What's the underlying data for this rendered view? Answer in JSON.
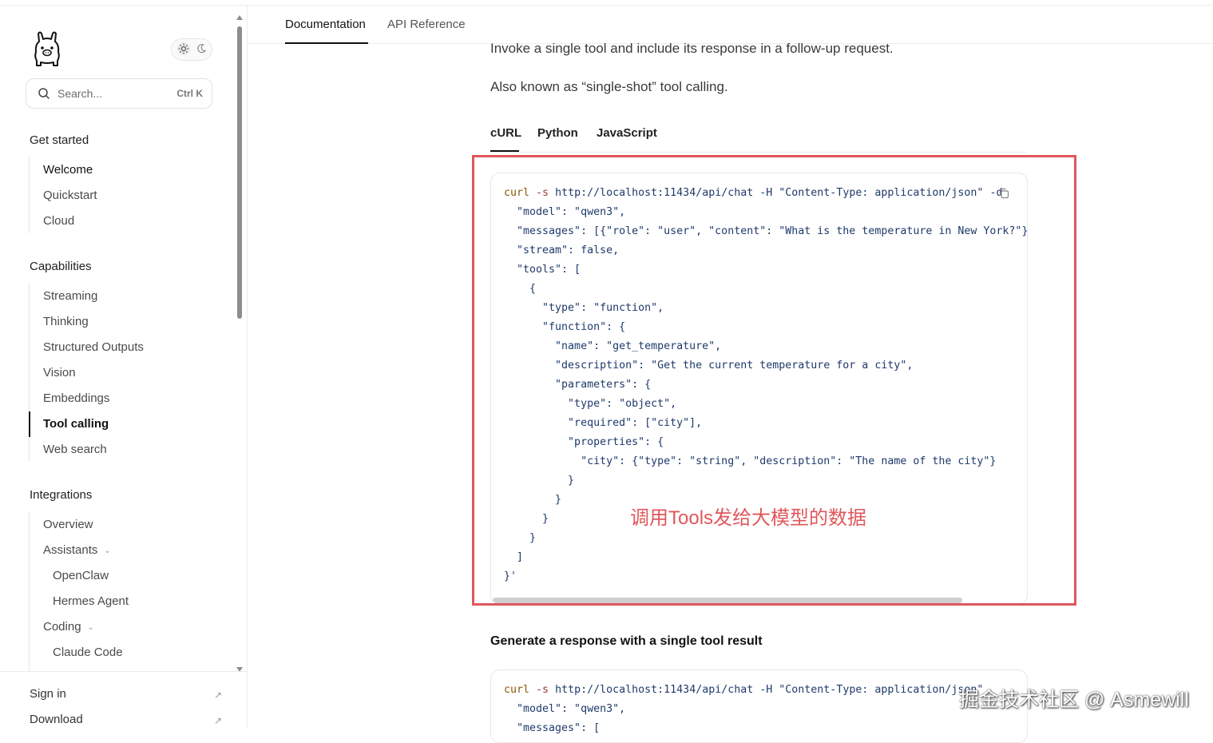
{
  "top_tabs": [
    "Documentation",
    "API Reference"
  ],
  "search": {
    "placeholder": "Search...",
    "shortcut": "Ctrl K"
  },
  "sidebar": {
    "sections": [
      {
        "title": "Get started",
        "items": [
          "Welcome",
          "Quickstart",
          "Cloud"
        ]
      },
      {
        "title": "Capabilities",
        "items": [
          "Streaming",
          "Thinking",
          "Structured Outputs",
          "Vision",
          "Embeddings",
          "Tool calling",
          "Web search"
        ]
      },
      {
        "title": "Integrations",
        "items": [
          "Overview",
          "Assistants",
          "OpenClaw",
          "Hermes Agent",
          "Coding",
          "Claude Code"
        ]
      }
    ],
    "active_item": "Tool calling",
    "footer": [
      "Sign in",
      "Download"
    ]
  },
  "main": {
    "intro": "Invoke a single tool and include its response in a follow-up request.",
    "aka": "Also known as “single-shot” tool calling.",
    "lang_tabs": [
      "cURL",
      "Python",
      "JavaScript"
    ],
    "code1": {
      "cmd": "curl",
      "flag": "-s",
      "first_rest": "http://localhost:11434/api/chat -H \"Content-Type: application/json\" -d",
      "lines": [
        "  \"model\": \"qwen3\",",
        "  \"messages\": [{\"role\": \"user\", \"content\": \"What is the temperature in New York?\"}],",
        "  \"stream\": false,",
        "  \"tools\": [",
        "    {",
        "      \"type\": \"function\",",
        "      \"function\": {",
        "        \"name\": \"get_temperature\",",
        "        \"description\": \"Get the current temperature for a city\",",
        "        \"parameters\": {",
        "          \"type\": \"object\",",
        "          \"required\": [\"city\"],",
        "          \"properties\": {",
        "            \"city\": {\"type\": \"string\", \"description\": \"The name of the city\"}",
        "          }",
        "        }",
        "      }",
        "    }",
        "  ]",
        "}'"
      ]
    },
    "annotation": "调用Tools发给大模型的数据",
    "heading2": "Generate a response with a single tool result",
    "code2": {
      "cmd": "curl",
      "flag": "-s",
      "first_rest": "http://localhost:11434/api/chat -H \"Content-Type: application/json\"",
      "lines": [
        "  \"model\": \"qwen3\",",
        "  \"messages\": ["
      ]
    }
  },
  "watermark": "掘金技术社区 @ Asmewill",
  "colors": {
    "annotation_red": "#e0575b"
  }
}
